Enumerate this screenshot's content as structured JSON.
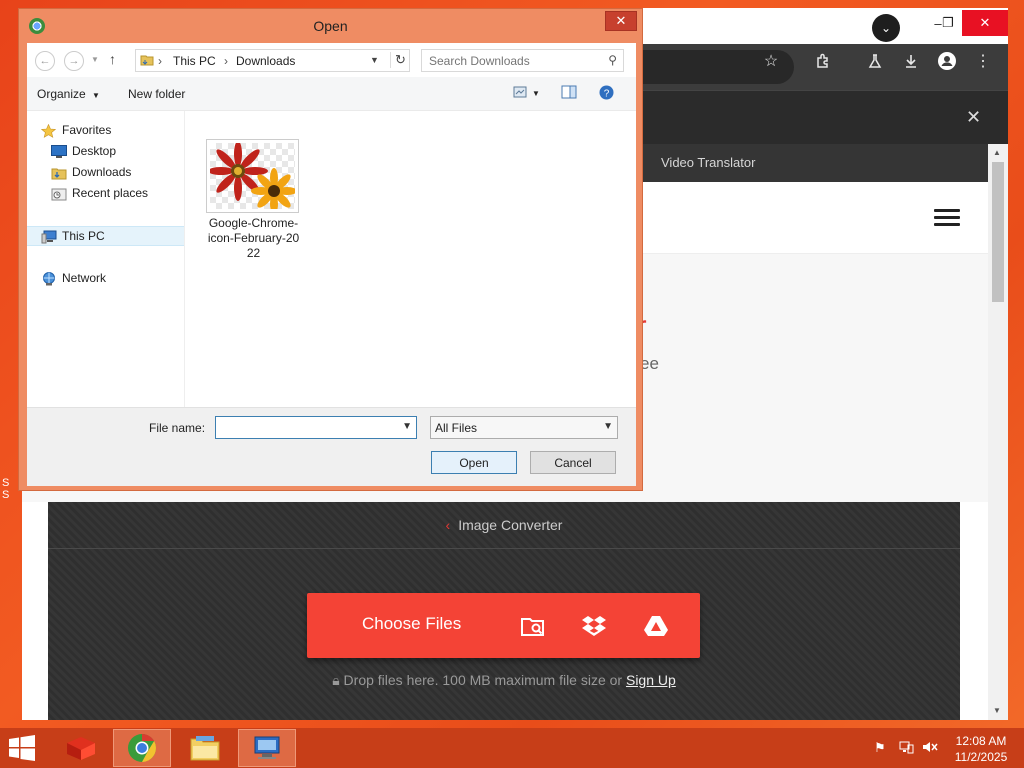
{
  "desktop": {
    "edge_text_top": "S",
    "edge_text_bottom": "S"
  },
  "chrome": {
    "tabs_button": "⌄",
    "window_controls": {
      "minimize": "–",
      "maximize": "❐",
      "close": "✕"
    },
    "nav_link": "Video Translator",
    "hero_heading_fragment": "er",
    "hero_sub_fragment": "ee",
    "converter": {
      "breadcrumb_label": "Image Converter",
      "choose_files_label": "Choose Files",
      "drop_text": "Drop files here. 100 MB maximum file size or",
      "signup_link": "Sign Up"
    }
  },
  "dialog": {
    "title": "Open",
    "close": "✕",
    "address": {
      "this_pc": "This PC",
      "separator": "›",
      "folder": "Downloads"
    },
    "search_placeholder": "Search Downloads",
    "organize_label": "Organize",
    "new_folder_label": "New folder",
    "nav": {
      "favorites": "Favorites",
      "desktop": "Desktop",
      "downloads": "Downloads",
      "recent_places": "Recent places",
      "this_pc": "This PC",
      "network": "Network"
    },
    "files": [
      {
        "name_line1": "Google-Chrome-",
        "name_line2": "icon-February-20",
        "name_line3": "22"
      }
    ],
    "file_name_label": "File name:",
    "file_name_value": "",
    "file_type_value": "All Files",
    "open_button": "Open",
    "cancel_button": "Cancel"
  },
  "taskbar": {
    "clock_time": "12:08 AM",
    "clock_date": "11/2/2025"
  },
  "colors": {
    "accent_red": "#f44336",
    "desktop_orange": "#e8431a",
    "taskbar": "#c73e18"
  }
}
